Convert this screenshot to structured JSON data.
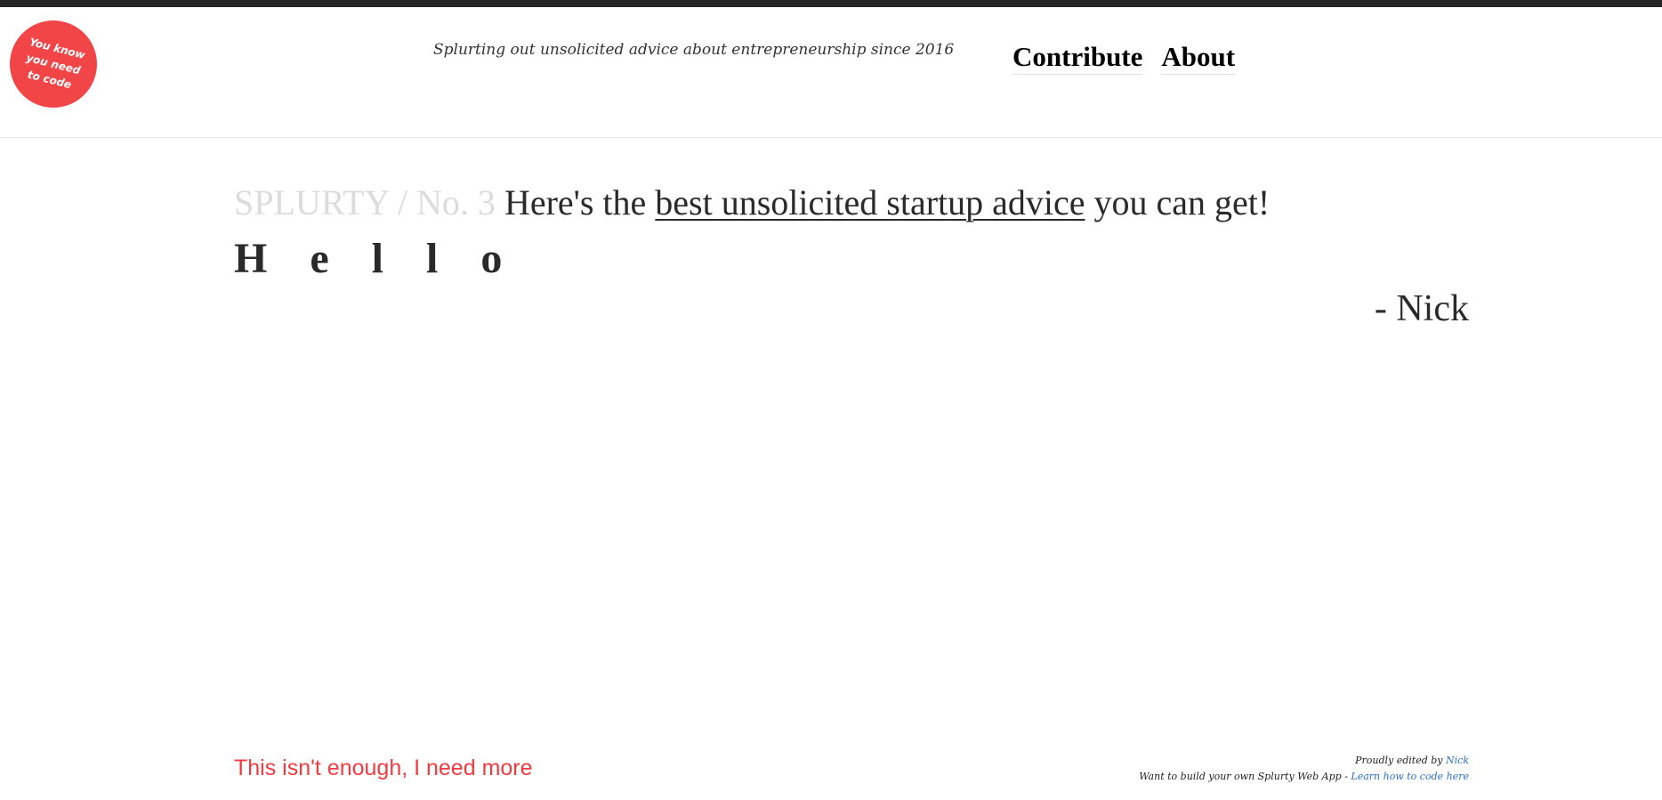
{
  "logo": {
    "text": "You know\nyou need\nto code",
    "color": "#f24547"
  },
  "header": {
    "tagline": "Splurting out unsolicited advice about entrepreneurship since 2016",
    "nav": {
      "contribute": "Contribute",
      "about": "About"
    }
  },
  "post": {
    "issue_label": "SPLURTY / No. 3",
    "headline_prefix": "Here's the",
    "headline_link": "best unsolicited startup advice",
    "headline_suffix": "you can get!",
    "advice_text": "Hello",
    "author": "- Nick"
  },
  "footer": {
    "more_link": "This isn't enough, I need more",
    "edited_by_label": "Proudly edited by",
    "editor_name": "Nick",
    "build_prompt": "Want to build your own Splurty Web App -",
    "learn_link": "Learn how to code here"
  },
  "colors": {
    "accent_red": "#f03c41",
    "link_blue": "#2c6fc9",
    "issue_gray": "#dcdcdc",
    "top_bar": "#262626"
  }
}
